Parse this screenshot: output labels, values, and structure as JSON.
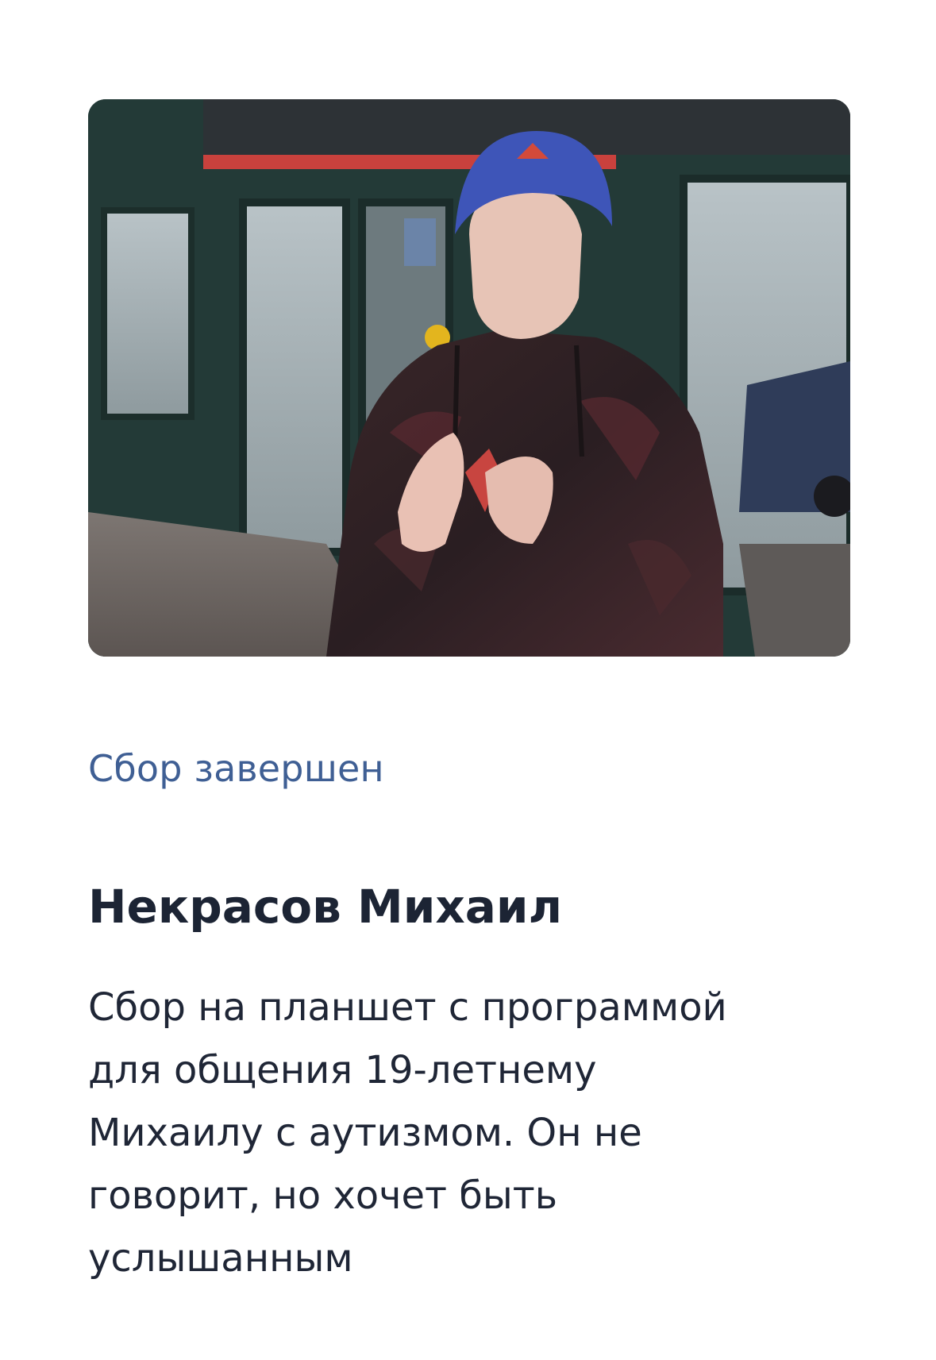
{
  "campaign": {
    "photo_subject": "young-man-in-blue-hat",
    "status": "Сбор завершен",
    "name": "Некрасов Михаил",
    "description_lines": [
      "Сбор на планшет с программой",
      "для общения 19-летнему",
      "Михаилу с аутизмом. Он не",
      "говорит, но хочет быть",
      "услышанным"
    ]
  },
  "colors": {
    "status": "#3f5f94",
    "title": "#1c2434",
    "text": "#1f2636",
    "background": "#ffffff"
  }
}
